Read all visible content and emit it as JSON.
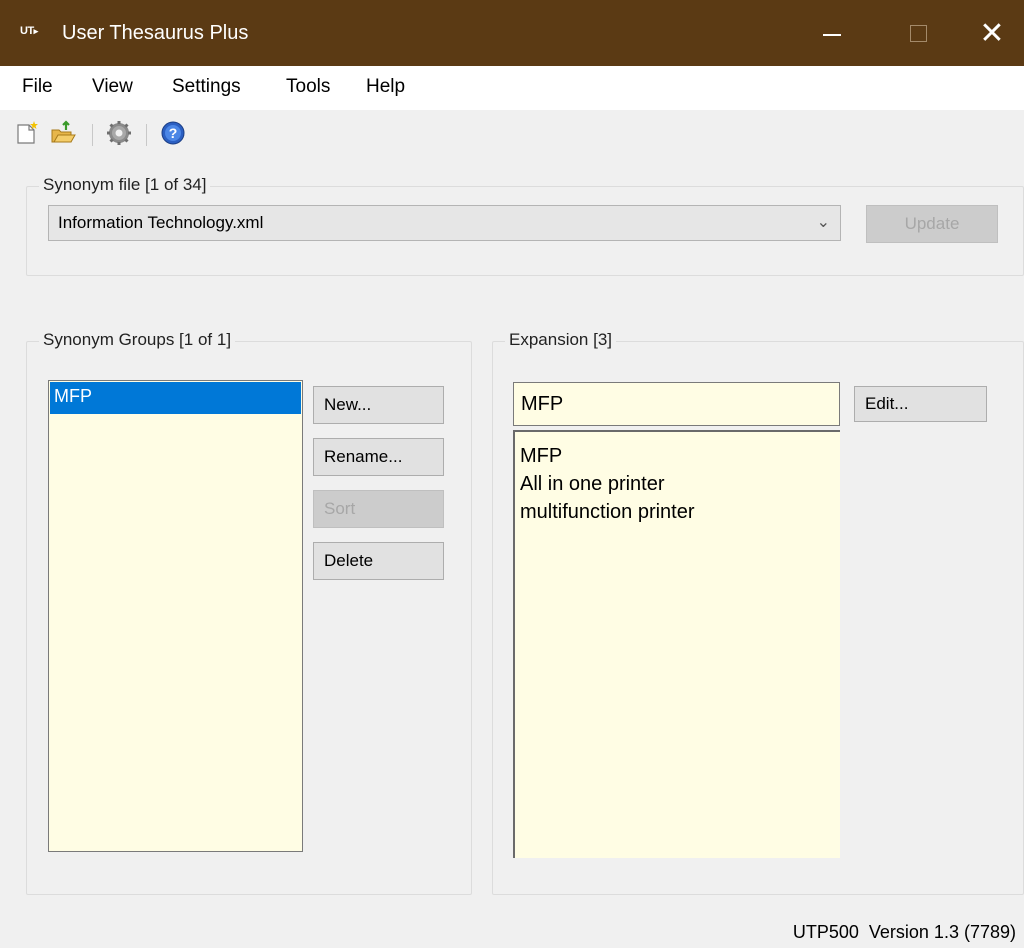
{
  "window": {
    "icon_text": "UT",
    "title": "User Thesaurus Plus",
    "close_glyph": "✕"
  },
  "menu": [
    "File",
    "View",
    "Settings",
    "Tools",
    "Help"
  ],
  "toolbar": {
    "icons": [
      "new-file-icon",
      "open-file-icon",
      "settings-gear-icon",
      "help-icon"
    ]
  },
  "synonym_file": {
    "group_label": "Synonym file [1 of 34]",
    "selected": "Information Technology.xml",
    "arrow": "⌄",
    "update_label": "Update"
  },
  "synonym_groups": {
    "group_label": "Synonym Groups [1 of 1]",
    "items": [
      "MFP"
    ],
    "buttons": {
      "new": "New...",
      "rename": "Rename...",
      "sort": "Sort",
      "delete": "Delete"
    }
  },
  "expansion": {
    "group_label": "Expansion [3]",
    "input_value": "MFP",
    "edit_label": "Edit...",
    "lines": [
      "MFP",
      "All in one printer",
      "multifunction printer"
    ]
  },
  "status": {
    "text": "UTP500  Version 1.3 (7789)"
  },
  "colors": {
    "titlebar": "#5b3a14",
    "selection": "#0078d7",
    "field_background": "#fffde4"
  }
}
